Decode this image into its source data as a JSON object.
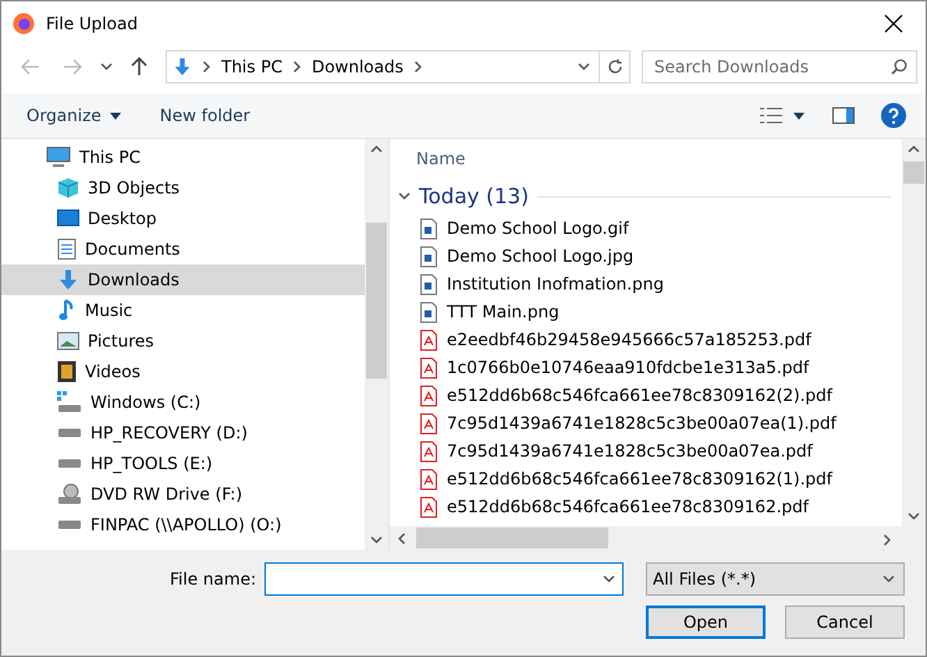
{
  "window": {
    "title": "File Upload"
  },
  "address_bar": {
    "path": [
      "This PC",
      "Downloads"
    ]
  },
  "search": {
    "placeholder": "Search Downloads"
  },
  "toolbar": {
    "organize": "Organize",
    "new_folder": "New folder"
  },
  "sidebar": {
    "items": [
      {
        "label": "This PC",
        "kind": "pc",
        "selected": false,
        "children": [
          {
            "label": "3D Objects",
            "kind": "objects",
            "selected": false
          },
          {
            "label": "Desktop",
            "kind": "desktop",
            "selected": false
          },
          {
            "label": "Documents",
            "kind": "documents",
            "selected": false
          },
          {
            "label": "Downloads",
            "kind": "downloads",
            "selected": true
          },
          {
            "label": "Music",
            "kind": "music",
            "selected": false
          },
          {
            "label": "Pictures",
            "kind": "pictures",
            "selected": false
          },
          {
            "label": "Videos",
            "kind": "videos",
            "selected": false
          },
          {
            "label": "Windows (C:)",
            "kind": "windows-drive",
            "selected": false
          },
          {
            "label": "HP_RECOVERY (D:)",
            "kind": "drive",
            "selected": false
          },
          {
            "label": "HP_TOOLS (E:)",
            "kind": "drive",
            "selected": false
          },
          {
            "label": "DVD RW Drive (F:)",
            "kind": "dvd",
            "selected": false
          },
          {
            "label": "FINPAC (\\\\APOLLO) (O:)",
            "kind": "drive",
            "selected": false
          }
        ]
      }
    ]
  },
  "file_list": {
    "column": "Name",
    "group": {
      "label": "Today (13)",
      "expanded": true
    },
    "rows": [
      {
        "name": "Demo School Logo.gif",
        "kind": "image"
      },
      {
        "name": "Demo School Logo.jpg",
        "kind": "image"
      },
      {
        "name": "Institution Inofmation.png",
        "kind": "image"
      },
      {
        "name": "TTT Main.png",
        "kind": "image"
      },
      {
        "name": "e2eedbf46b29458e945666c57a185253.pdf",
        "kind": "pdf"
      },
      {
        "name": "1c0766b0e10746eaa910fdcbe1e313a5.pdf",
        "kind": "pdf"
      },
      {
        "name": "e512dd6b68c546fca661ee78c8309162(2).pdf",
        "kind": "pdf"
      },
      {
        "name": "7c95d1439a6741e1828c5c3be00a07ea(1).pdf",
        "kind": "pdf"
      },
      {
        "name": "7c95d1439a6741e1828c5c3be00a07ea.pdf",
        "kind": "pdf"
      },
      {
        "name": "e512dd6b68c546fca661ee78c8309162(1).pdf",
        "kind": "pdf"
      },
      {
        "name": "e512dd6b68c546fca661ee78c8309162.pdf",
        "kind": "pdf"
      }
    ]
  },
  "footer": {
    "file_name_label": "File name:",
    "file_type": "All Files (*.*)",
    "buttons": [
      "Open",
      "Cancel"
    ]
  }
}
